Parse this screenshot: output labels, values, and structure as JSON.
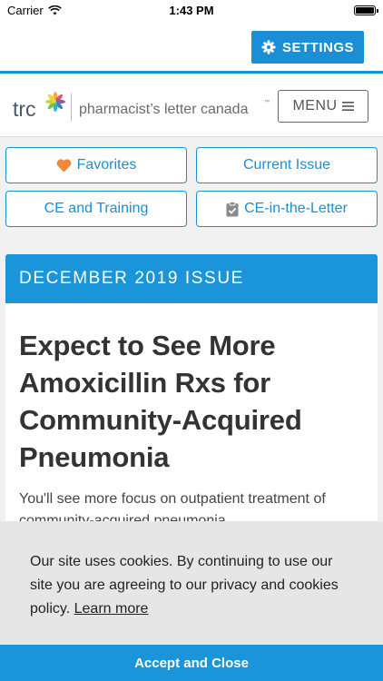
{
  "status_bar": {
    "carrier": "Carrier",
    "time": "1:43 PM"
  },
  "topbar": {
    "settings_label": "SETTINGS"
  },
  "brand": {
    "logo_short": "trc",
    "product_name": "pharmacist’s letter canada",
    "trademark": "™",
    "menu_label": "MENU"
  },
  "nav": {
    "favorites": "Favorites",
    "current_issue": "Current Issue",
    "ce_training": "CE and Training",
    "ce_in_letter": "CE-in-the-Letter"
  },
  "issue": {
    "header": "DECEMBER 2019 ISSUE",
    "title": "Expect to See More Amoxicillin Rxs for Community-Acquired Pneumonia",
    "summary": "You'll see more focus on outpatient treatment of community-acquired pneumonia."
  },
  "cookie": {
    "message": "Our site uses cookies. By continuing to use our site you are agreeing to our privacy and cookies policy.",
    "learn_more": "Learn more",
    "accept": "Accept and Close"
  },
  "colors": {
    "accent": "#1a8fd6",
    "heart": "#f0883a",
    "banner_bg": "#e6e6e6"
  }
}
